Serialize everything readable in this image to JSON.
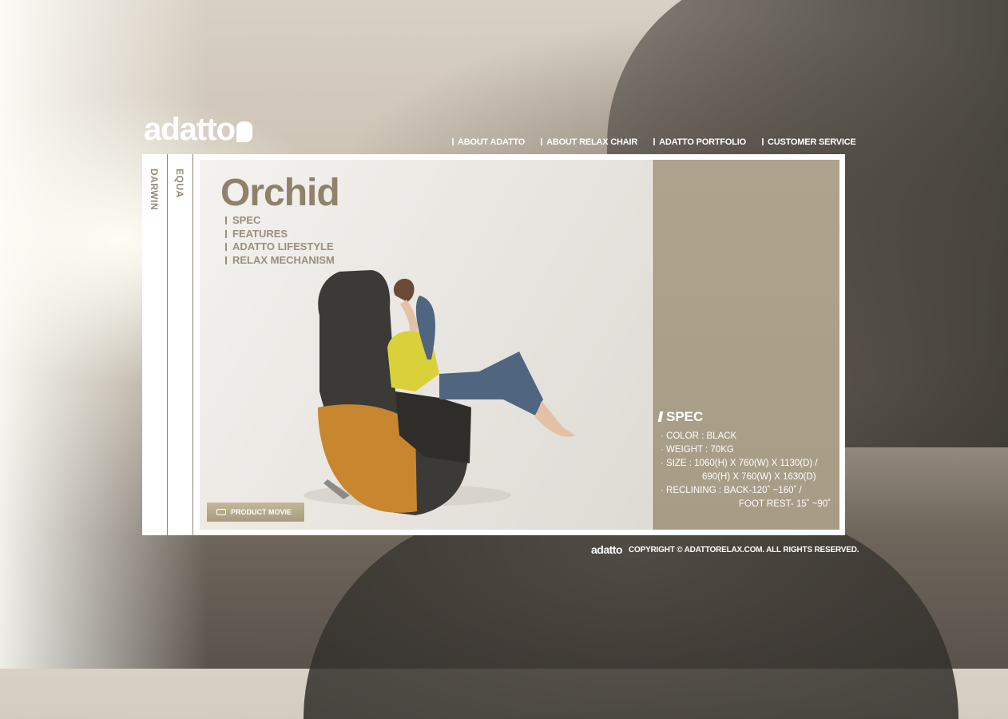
{
  "brand": {
    "logo_text": "adatto",
    "footer_logo_text": "adatto"
  },
  "topnav": [
    {
      "label": "ABOUT ADATTO"
    },
    {
      "label": "ABOUT RELAX CHAIR"
    },
    {
      "label": "ADATTO PORTFOLIO"
    },
    {
      "label": "CUSTOMER SERVICE"
    }
  ],
  "side_tabs": [
    {
      "label": "DARWIN"
    },
    {
      "label": "EQUA"
    }
  ],
  "product": {
    "name": "Orchid",
    "submenu": [
      "SPEC",
      "FEATURES",
      "ADATTO LIFESTYLE",
      "RELAX MECHANISM"
    ],
    "movie_button": "PRODUCT  MOVIE"
  },
  "spec": {
    "title": "SPEC",
    "color": "· COLOR : BLACK",
    "weight": "· WEIGHT : 70KG",
    "size_line1": "· SIZE : 1060(H) X 760(W) X 1130(D) /",
    "size_line2": "690(H) X 760(W) X 1630(D)",
    "reclining_line1": "· RECLINING : BACK-120˚ ~160˚ /",
    "reclining_line2": "FOOT REST- 15˚ ~90˚"
  },
  "footer": {
    "copyright": "COPYRIGHT © ADATTORELAX.COM. ALL RIGHTS RESERVED."
  }
}
